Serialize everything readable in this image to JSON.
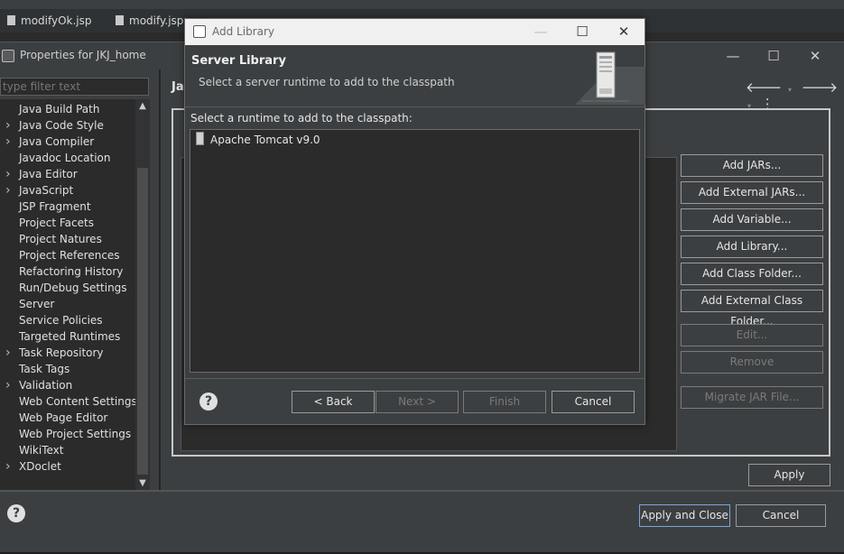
{
  "ide": {
    "tabs": [
      {
        "label": "modifyOk.jsp"
      },
      {
        "label": "modify.jsp"
      }
    ]
  },
  "properties_window": {
    "title": "Properties for JKJ_home",
    "filter_placeholder": "type filter text",
    "page_heading": "Jav",
    "tree_items": [
      {
        "label": "Java Build Path",
        "expandable": false
      },
      {
        "label": "Java Code Style",
        "expandable": true
      },
      {
        "label": "Java Compiler",
        "expandable": true
      },
      {
        "label": "Javadoc Location",
        "expandable": false
      },
      {
        "label": "Java Editor",
        "expandable": true
      },
      {
        "label": "JavaScript",
        "expandable": true
      },
      {
        "label": "JSP Fragment",
        "expandable": false
      },
      {
        "label": "Project Facets",
        "expandable": false
      },
      {
        "label": "Project Natures",
        "expandable": false
      },
      {
        "label": "Project References",
        "expandable": false
      },
      {
        "label": "Refactoring History",
        "expandable": false
      },
      {
        "label": "Run/Debug Settings",
        "expandable": false
      },
      {
        "label": "Server",
        "expandable": false
      },
      {
        "label": "Service Policies",
        "expandable": false
      },
      {
        "label": "Targeted Runtimes",
        "expandable": false
      },
      {
        "label": "Task Repository",
        "expandable": true
      },
      {
        "label": "Task Tags",
        "expandable": false
      },
      {
        "label": "Validation",
        "expandable": true
      },
      {
        "label": "Web Content Settings",
        "expandable": false
      },
      {
        "label": "Web Page Editor",
        "expandable": false
      },
      {
        "label": "Web Project Settings",
        "expandable": false
      },
      {
        "label": "WikiText",
        "expandable": false
      },
      {
        "label": "XDoclet",
        "expandable": true
      }
    ],
    "side_buttons": {
      "add_jars": "Add JARs...",
      "add_external_jars": "Add External JARs...",
      "add_variable": "Add Variable...",
      "add_library": "Add Library...",
      "add_class_folder": "Add Class Folder...",
      "add_external_class_folder": "Add External Class Folder...",
      "edit": "Edit...",
      "remove": "Remove",
      "migrate_jar": "Migrate JAR File..."
    },
    "apply": "Apply",
    "apply_and_close": "Apply and Close",
    "cancel": "Cancel"
  },
  "dialog": {
    "title": "Add Library",
    "wizard_title": "Server Library",
    "wizard_description": "Select a server runtime to add to the classpath",
    "list_label": "Select a runtime to add to the classpath:",
    "runtimes": [
      {
        "label": "Apache Tomcat v9.0"
      }
    ],
    "buttons": {
      "back": "< Back",
      "next": "Next >",
      "finish": "Finish",
      "cancel": "Cancel"
    }
  },
  "icons": {
    "help": "?",
    "minimize": "—",
    "maximize": "☐",
    "close": "✕",
    "back_arrow": "🡐",
    "forward_arrow": "🡒",
    "menu": "⋮"
  }
}
